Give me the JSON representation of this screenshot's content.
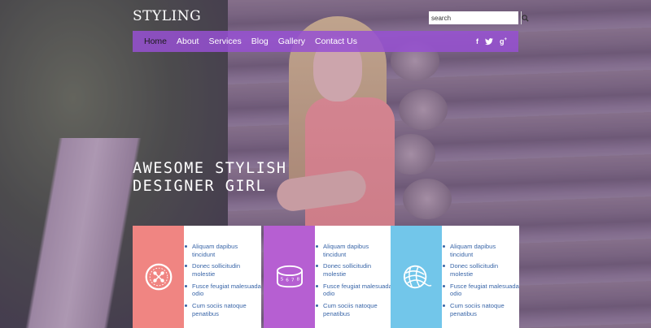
{
  "header": {
    "logo": "STYLING",
    "search": {
      "placeholder": "search"
    },
    "nav": [
      "Home",
      "About",
      "Services",
      "Blog",
      "Gallery",
      "Contact Us"
    ],
    "active_nav": "Home",
    "social": [
      {
        "icon": "facebook-icon",
        "glyph": "f"
      },
      {
        "icon": "twitter-icon",
        "glyph": "t"
      },
      {
        "icon": "google-plus-icon",
        "glyph": "g+"
      }
    ]
  },
  "hero": {
    "line1": "AWESOME STYLISH",
    "line2": "DESIGNER GIRL"
  },
  "cards": [
    {
      "icon": "button-icon",
      "color": "#f08582",
      "items": [
        "Aliquam dapibus tincidunt",
        "Donec sollicitudin molestie",
        "Fusce feugiat malesuada odio",
        "Cum sociis natoque penatibus"
      ]
    },
    {
      "icon": "measuring-tape-icon",
      "color": "#b65fd2",
      "items": [
        "Aliquam dapibus tincidunt",
        "Donec sollicitudin molestie",
        "Fusce feugiat malesuada odio",
        "Cum sociis natoque penatibus"
      ]
    },
    {
      "icon": "yarn-ball-icon",
      "color": "#72c6ea",
      "items": [
        "Aliquam dapibus tincidunt",
        "Donec sollicitudin molestie",
        "Fusce feugiat malesuada odio",
        "Cum sociis natoque penatibus"
      ]
    }
  ]
}
